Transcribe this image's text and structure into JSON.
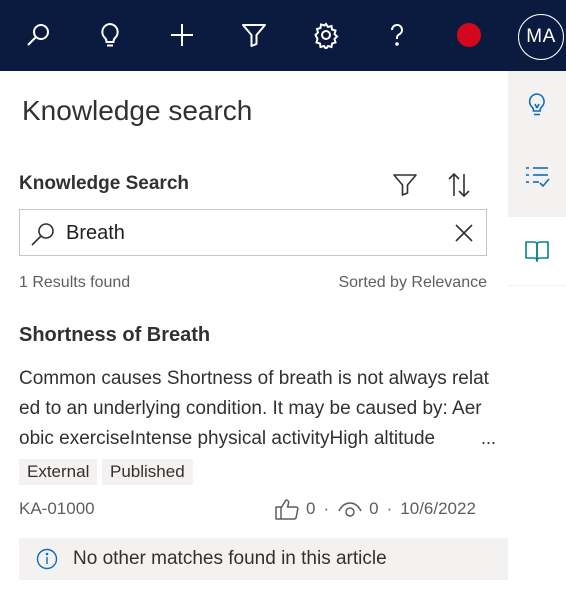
{
  "topbar": {
    "icons": [
      "search-icon",
      "lightbulb-icon",
      "plus-icon",
      "filter-icon",
      "gear-icon",
      "help-icon",
      "record-icon"
    ],
    "avatar_initials": "MA",
    "background": "#0b1a3f",
    "record_color": "#d4081c"
  },
  "panel": {
    "title": "Knowledge search",
    "section_title": "Knowledge Search",
    "search": {
      "value": "Breath",
      "placeholder": ""
    },
    "results_count": "1 Results found",
    "sorted_by": "Sorted by Relevance",
    "results": [
      {
        "title": "Shortness of Breath",
        "snippet": "Common causes Shortness of breath is not always related to an underlying condition. It may be caused by: Aerobic exerciseIntense physical activityHigh altitude",
        "ellipsis": "...",
        "tags": [
          "External",
          "Published"
        ],
        "id": "KA-01000",
        "likes": "0",
        "views": "0",
        "date": "10/6/2022",
        "separator": "·"
      }
    ],
    "info_message": "No other matches found in this article"
  },
  "rail": {
    "items": [
      "lightbulb-icon",
      "checklist-icon",
      "book-icon"
    ],
    "accent": "#0f6cbd",
    "active_accent": "#038387"
  }
}
